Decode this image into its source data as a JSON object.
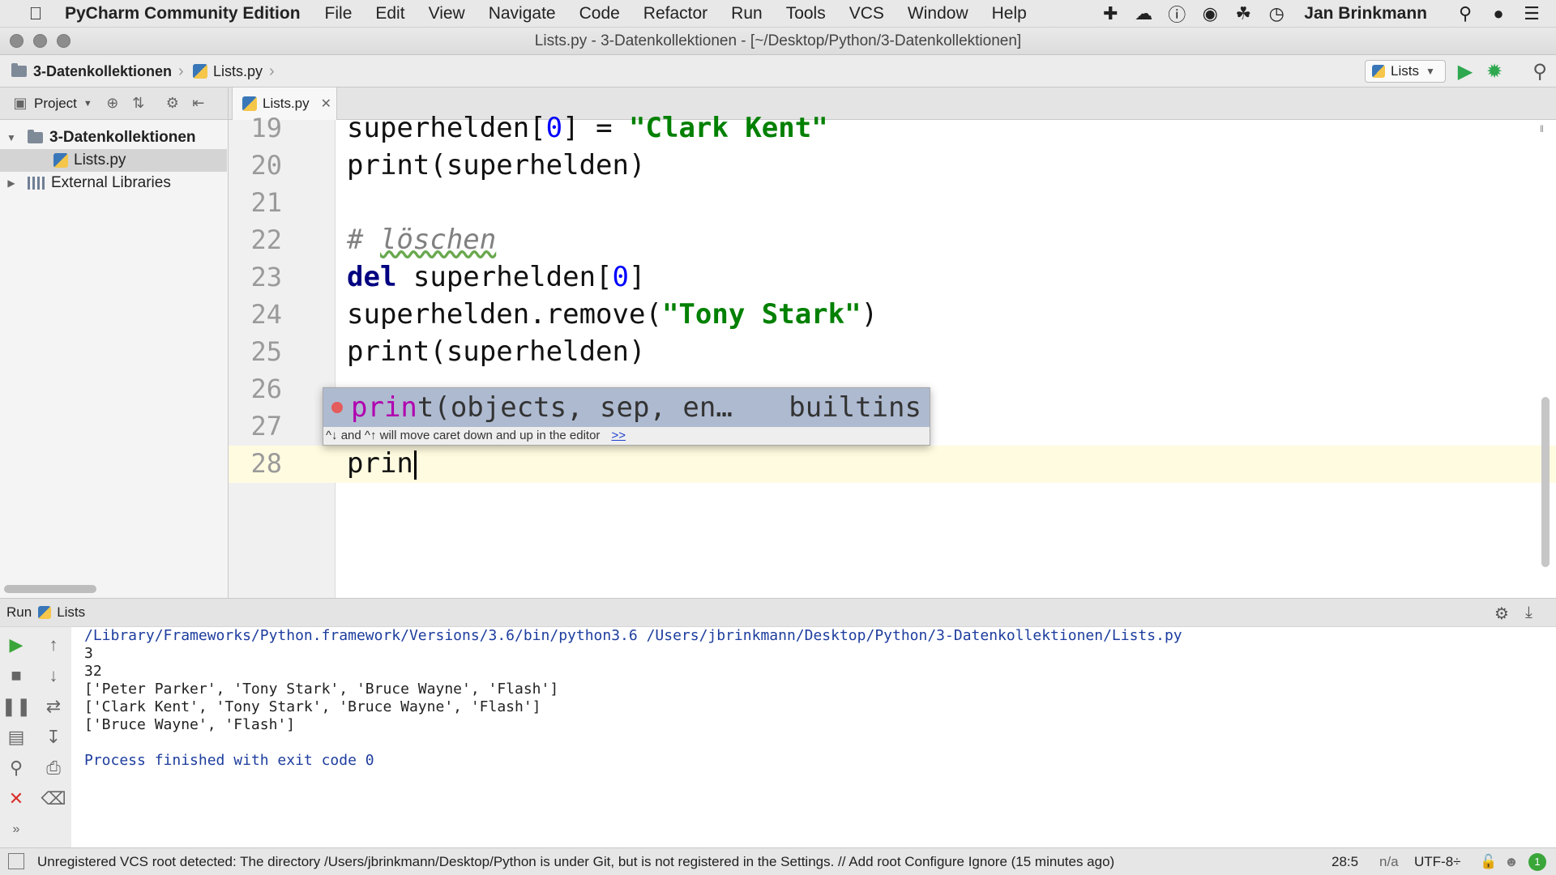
{
  "menubar": {
    "apple_icon": "apple-logo",
    "app_name": "PyCharm Community Edition",
    "items": [
      "File",
      "Edit",
      "View",
      "Navigate",
      "Code",
      "Refactor",
      "Run",
      "Tools",
      "VCS",
      "Window",
      "Help"
    ],
    "user": "Jan Brinkmann"
  },
  "window": {
    "title": "Lists.py - 3-Datenkollektionen - [~/Desktop/Python/3-Datenkollektionen]"
  },
  "navbar": {
    "breadcrumb": [
      "3-Datenkollektionen",
      "Lists.py"
    ],
    "run_config": "Lists"
  },
  "project": {
    "label": "Project",
    "root": "3-Datenkollektionen",
    "file": "Lists.py",
    "libraries": "External Libraries"
  },
  "editor": {
    "tab": "Lists.py",
    "line_numbers": [
      "19",
      "20",
      "21",
      "22",
      "23",
      "24",
      "25",
      "26",
      "27",
      "28"
    ],
    "l19": {
      "ident": "superhelden",
      "lb": "[",
      "num": "0",
      "rest": "] = ",
      "str": "\"Clark Kent\""
    },
    "l20": "print(superhelden)",
    "l22": {
      "hash": "# ",
      "word": "löschen"
    },
    "l23": {
      "kw": "del",
      "ident": " superhelden[",
      "num": "0",
      "rb": "]"
    },
    "l24": {
      "call": "superhelden.remove(",
      "str": "\"Tony Stark\"",
      "close": ")"
    },
    "l25": "print(superhelden)",
    "l28": "prin"
  },
  "completion": {
    "match": "prin",
    "rest": "t(objects, sep, en…",
    "source": "builtins",
    "hint": "^↓ and ^↑ will move caret down and up in the editor",
    "more": ">>"
  },
  "run": {
    "label": "Run",
    "config": "Lists",
    "output": [
      "/Library/Frameworks/Python.framework/Versions/3.6/bin/python3.6 /Users/jbrinkmann/Desktop/Python/3-Datenkollektionen/Lists.py",
      "3",
      "32",
      "['Peter Parker', 'Tony Stark', 'Bruce Wayne', 'Flash']",
      "['Clark Kent', 'Tony Stark', 'Bruce Wayne', 'Flash']",
      "['Bruce Wayne', 'Flash']",
      "",
      "Process finished with exit code 0"
    ]
  },
  "status": {
    "message": "Unregistered VCS root detected: The directory /Users/jbrinkmann/Desktop/Python is under Git, but is not registered in the Settings. // Add root  Configure  Ignore (15 minutes ago)",
    "position": "28:5",
    "na": "n/a",
    "encoding": "UTF-8÷"
  },
  "colors": {
    "keyword": "#000080",
    "string": "#008000",
    "number": "#0000ff",
    "comment": "#808080",
    "completion_match": "#b000b0",
    "current_line": "#fffbe0",
    "run_green": "#3aa63a",
    "stop_red": "#d9302c"
  }
}
